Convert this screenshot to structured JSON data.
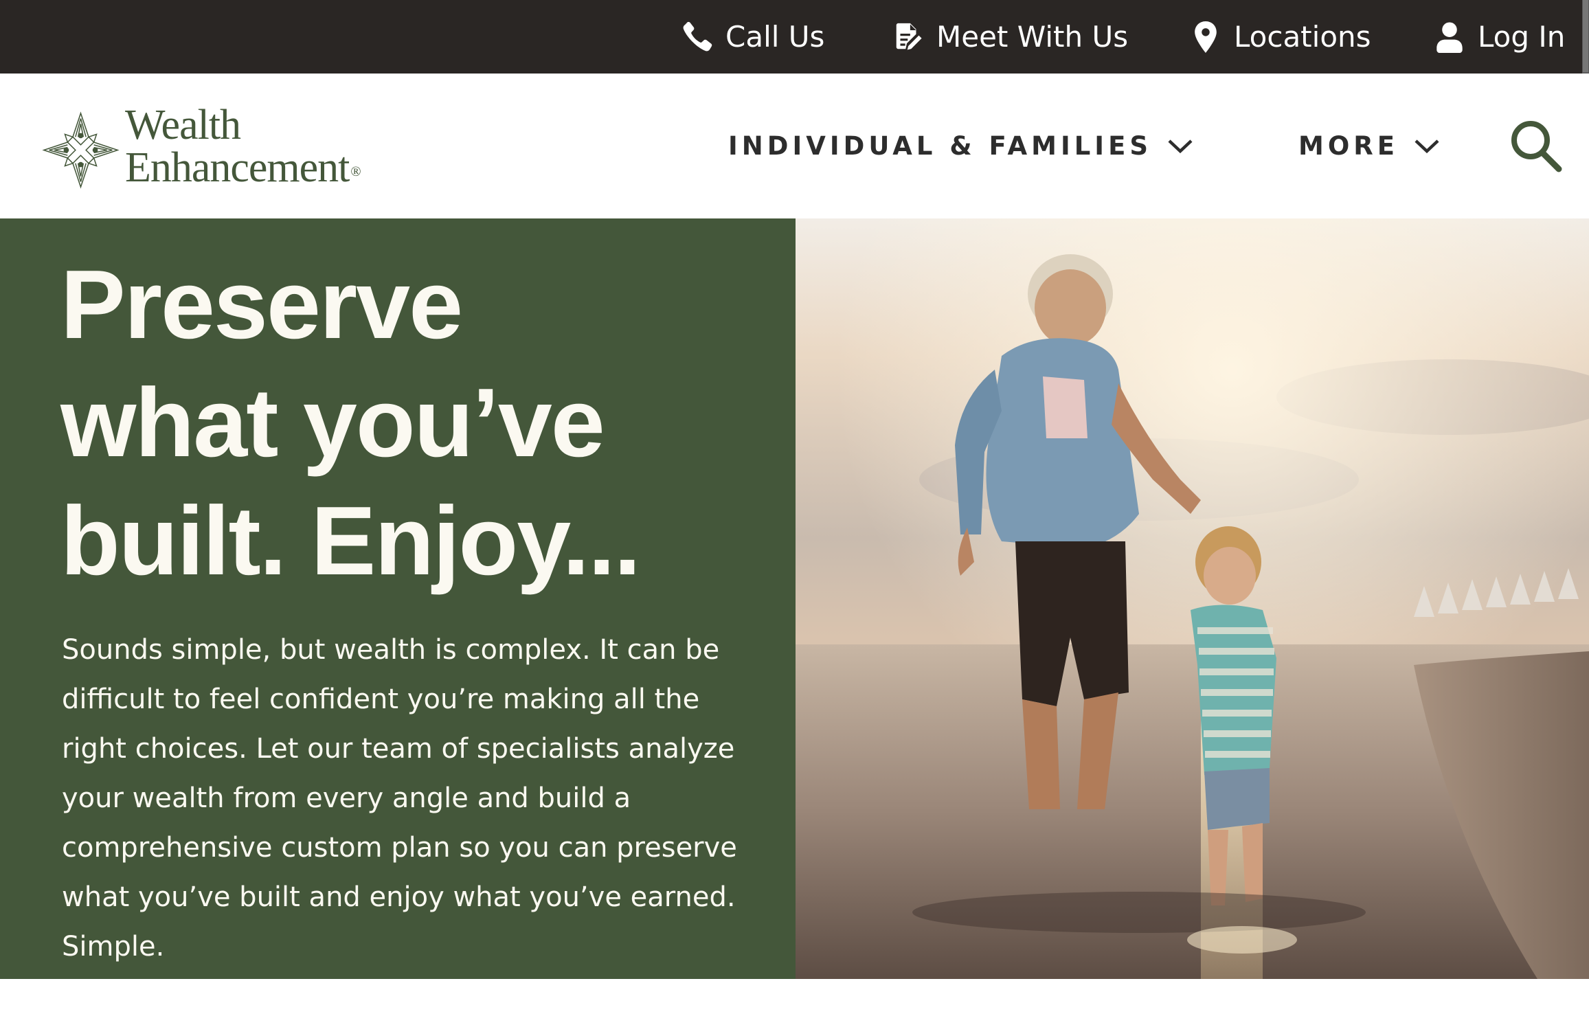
{
  "utility_bar": {
    "items": [
      {
        "label": "Call Us",
        "icon": "phone-icon"
      },
      {
        "label": "Meet With Us",
        "icon": "document-edit-icon"
      },
      {
        "label": "Locations",
        "icon": "map-pin-icon"
      },
      {
        "label": "Log In",
        "icon": "user-icon"
      }
    ]
  },
  "brand": {
    "name_line1": "Wealth",
    "name_line2": "Enhancement",
    "registered_mark": "®",
    "color": "#44573a"
  },
  "main_nav": {
    "items": [
      {
        "label": "INDIVIDUAL & FAMILIES",
        "icon": "chevron-down-icon"
      },
      {
        "label": "MORE",
        "icon": "chevron-down-icon"
      }
    ],
    "search_icon": "search-icon"
  },
  "hero": {
    "title_lines": [
      "Preserve",
      "what you’ve",
      "built. Enjoy..."
    ],
    "body": "Sounds simple, but wealth is complex. It can be difficult to feel confident you’re making all the right choices. Let our team of specialists analyze your wealth from every angle and build a comprehensive custom plan so you can preserve what you’ve built and enjoy what you’ve earned. Simple.",
    "panel_color": "#44573a",
    "text_color": "#fbf9f1",
    "image_alt": "Grandfather and grandson walking hand in hand in the surf at sunset"
  },
  "colors": {
    "utility_bar_bg": "#2a2624",
    "nav_text": "#2d2d2d",
    "accent": "#44573a"
  }
}
